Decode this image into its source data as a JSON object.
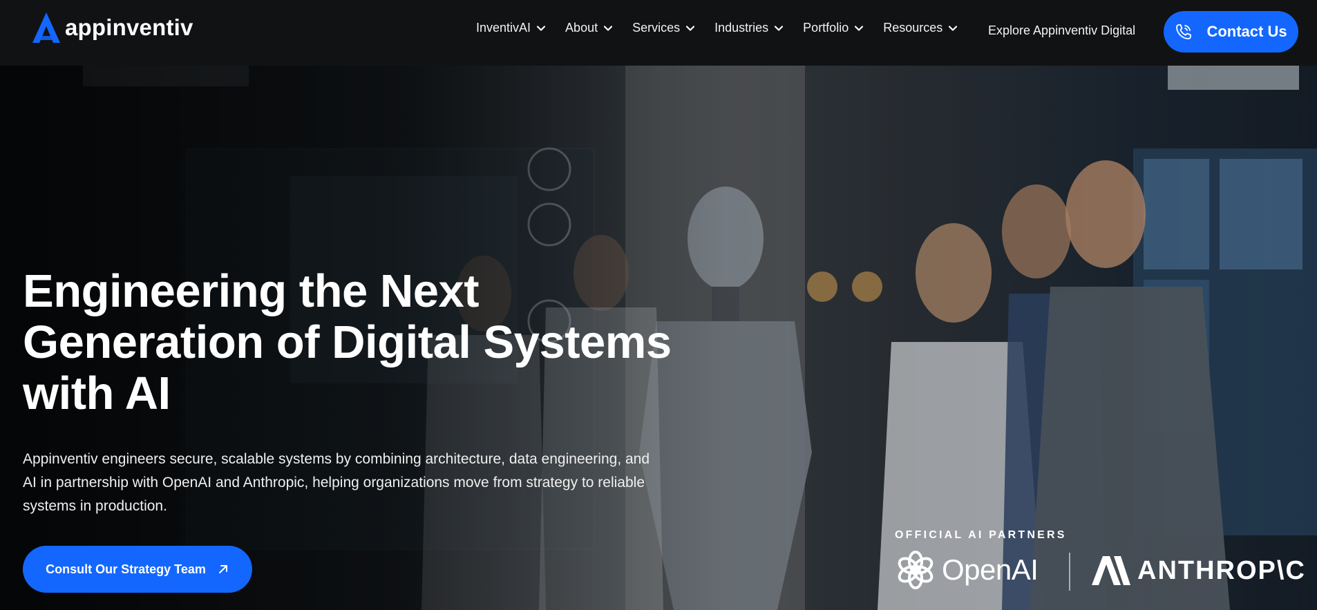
{
  "brand": {
    "name": "appinventiv",
    "accent": "#1367FF"
  },
  "nav": {
    "items": [
      {
        "label": "InventivAI",
        "has_dropdown": true
      },
      {
        "label": "About",
        "has_dropdown": true
      },
      {
        "label": "Services",
        "has_dropdown": true
      },
      {
        "label": "Industries",
        "has_dropdown": true
      },
      {
        "label": "Portfolio",
        "has_dropdown": true
      },
      {
        "label": "Resources",
        "has_dropdown": true
      }
    ],
    "explore_label": "Explore Appinventiv Digital",
    "contact": {
      "label": "Contact Us",
      "icon": "phone-icon"
    }
  },
  "hero": {
    "title": "Engineering the Next Generation of Digital Systems with AI",
    "description": "Appinventiv engineers secure, scalable systems by combining architecture, data engineering, and AI in partnership with OpenAI and Anthropic, helping organizations move from strategy to reliable systems in production.",
    "cta": {
      "label": "Consult Our Strategy Team",
      "icon": "arrow-up-right-icon"
    },
    "partners": {
      "label": "OFFICIAL AI PARTNERS",
      "items": [
        {
          "name": "OpenAI",
          "icon": "openai-logo-icon"
        },
        {
          "name": "ANTHROP\\C",
          "icon": "anthropic-logo-icon"
        }
      ]
    }
  }
}
